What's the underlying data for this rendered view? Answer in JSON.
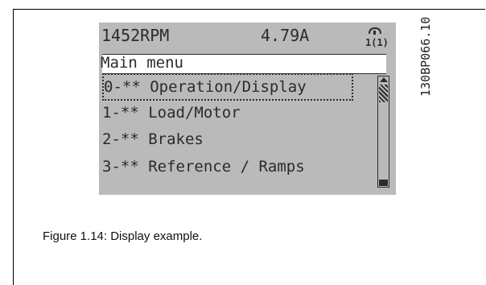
{
  "display": {
    "speed": "1452RPM",
    "current": "4.79A",
    "mode_icon": "hand-on-icon",
    "mode_text": "1(1)",
    "title": "Main menu",
    "menu_items": [
      {
        "label": "0-** Operation/Display"
      },
      {
        "label": "1-** Load/Motor"
      },
      {
        "label": "2-** Brakes"
      },
      {
        "label": "3-** Reference / Ramps"
      }
    ]
  },
  "figure": {
    "code": "130BP066.10",
    "caption": "Figure 1.14: Display example."
  },
  "colors": {
    "lcd_background": "#bababa",
    "lcd_text": "#2b2b2b"
  }
}
